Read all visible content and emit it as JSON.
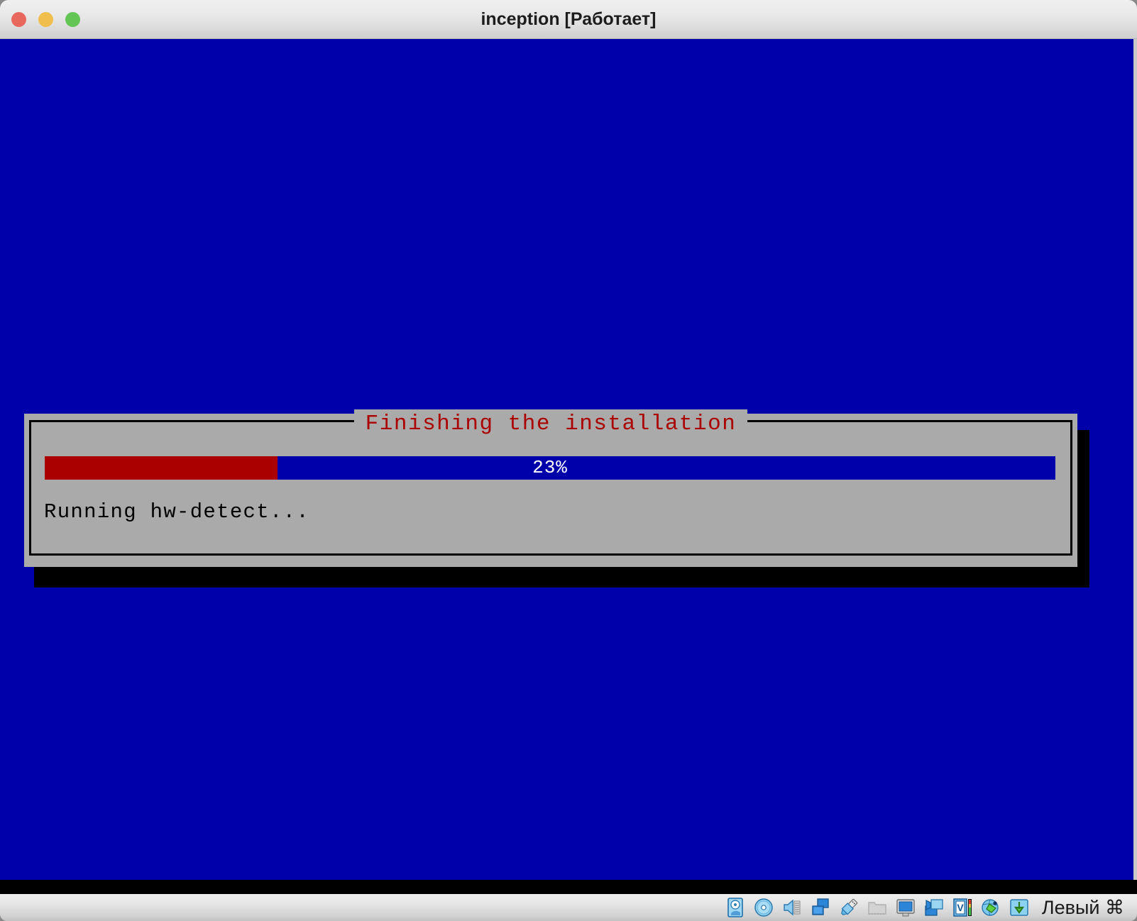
{
  "window": {
    "title": "inception [Работает]",
    "traffic_lights": [
      {
        "name": "close",
        "color": "#e8685d"
      },
      {
        "name": "minimize",
        "color": "#efbe4d"
      },
      {
        "name": "maximize",
        "color": "#62c554"
      }
    ]
  },
  "guest": {
    "background_color": "#0000aa",
    "dialog": {
      "title": "Finishing the installation",
      "title_color": "#aa0000",
      "background_color": "#aaaaaa",
      "border_color": "#000000",
      "progress": {
        "percent": 23,
        "percent_label": "23%",
        "fill_color": "#aa0000",
        "track_color": "#0000aa",
        "label_color": "#ffffff"
      },
      "status_text": "Running hw-detect..."
    }
  },
  "statusbar": {
    "host_key_label": "Левый ⌘",
    "icons": [
      {
        "name": "hard-disk-icon",
        "enabled": true
      },
      {
        "name": "optical-disk-icon",
        "enabled": true
      },
      {
        "name": "audio-icon",
        "enabled": true
      },
      {
        "name": "network-icon",
        "enabled": true
      },
      {
        "name": "usb-icon",
        "enabled": true
      },
      {
        "name": "shared-folders-icon",
        "enabled": false
      },
      {
        "name": "display-icon",
        "enabled": true
      },
      {
        "name": "video-capture-icon",
        "enabled": true
      },
      {
        "name": "virtualization-icon",
        "enabled": true
      },
      {
        "name": "mouse-integration-icon",
        "enabled": true
      },
      {
        "name": "host-key-icon",
        "enabled": true
      }
    ]
  }
}
